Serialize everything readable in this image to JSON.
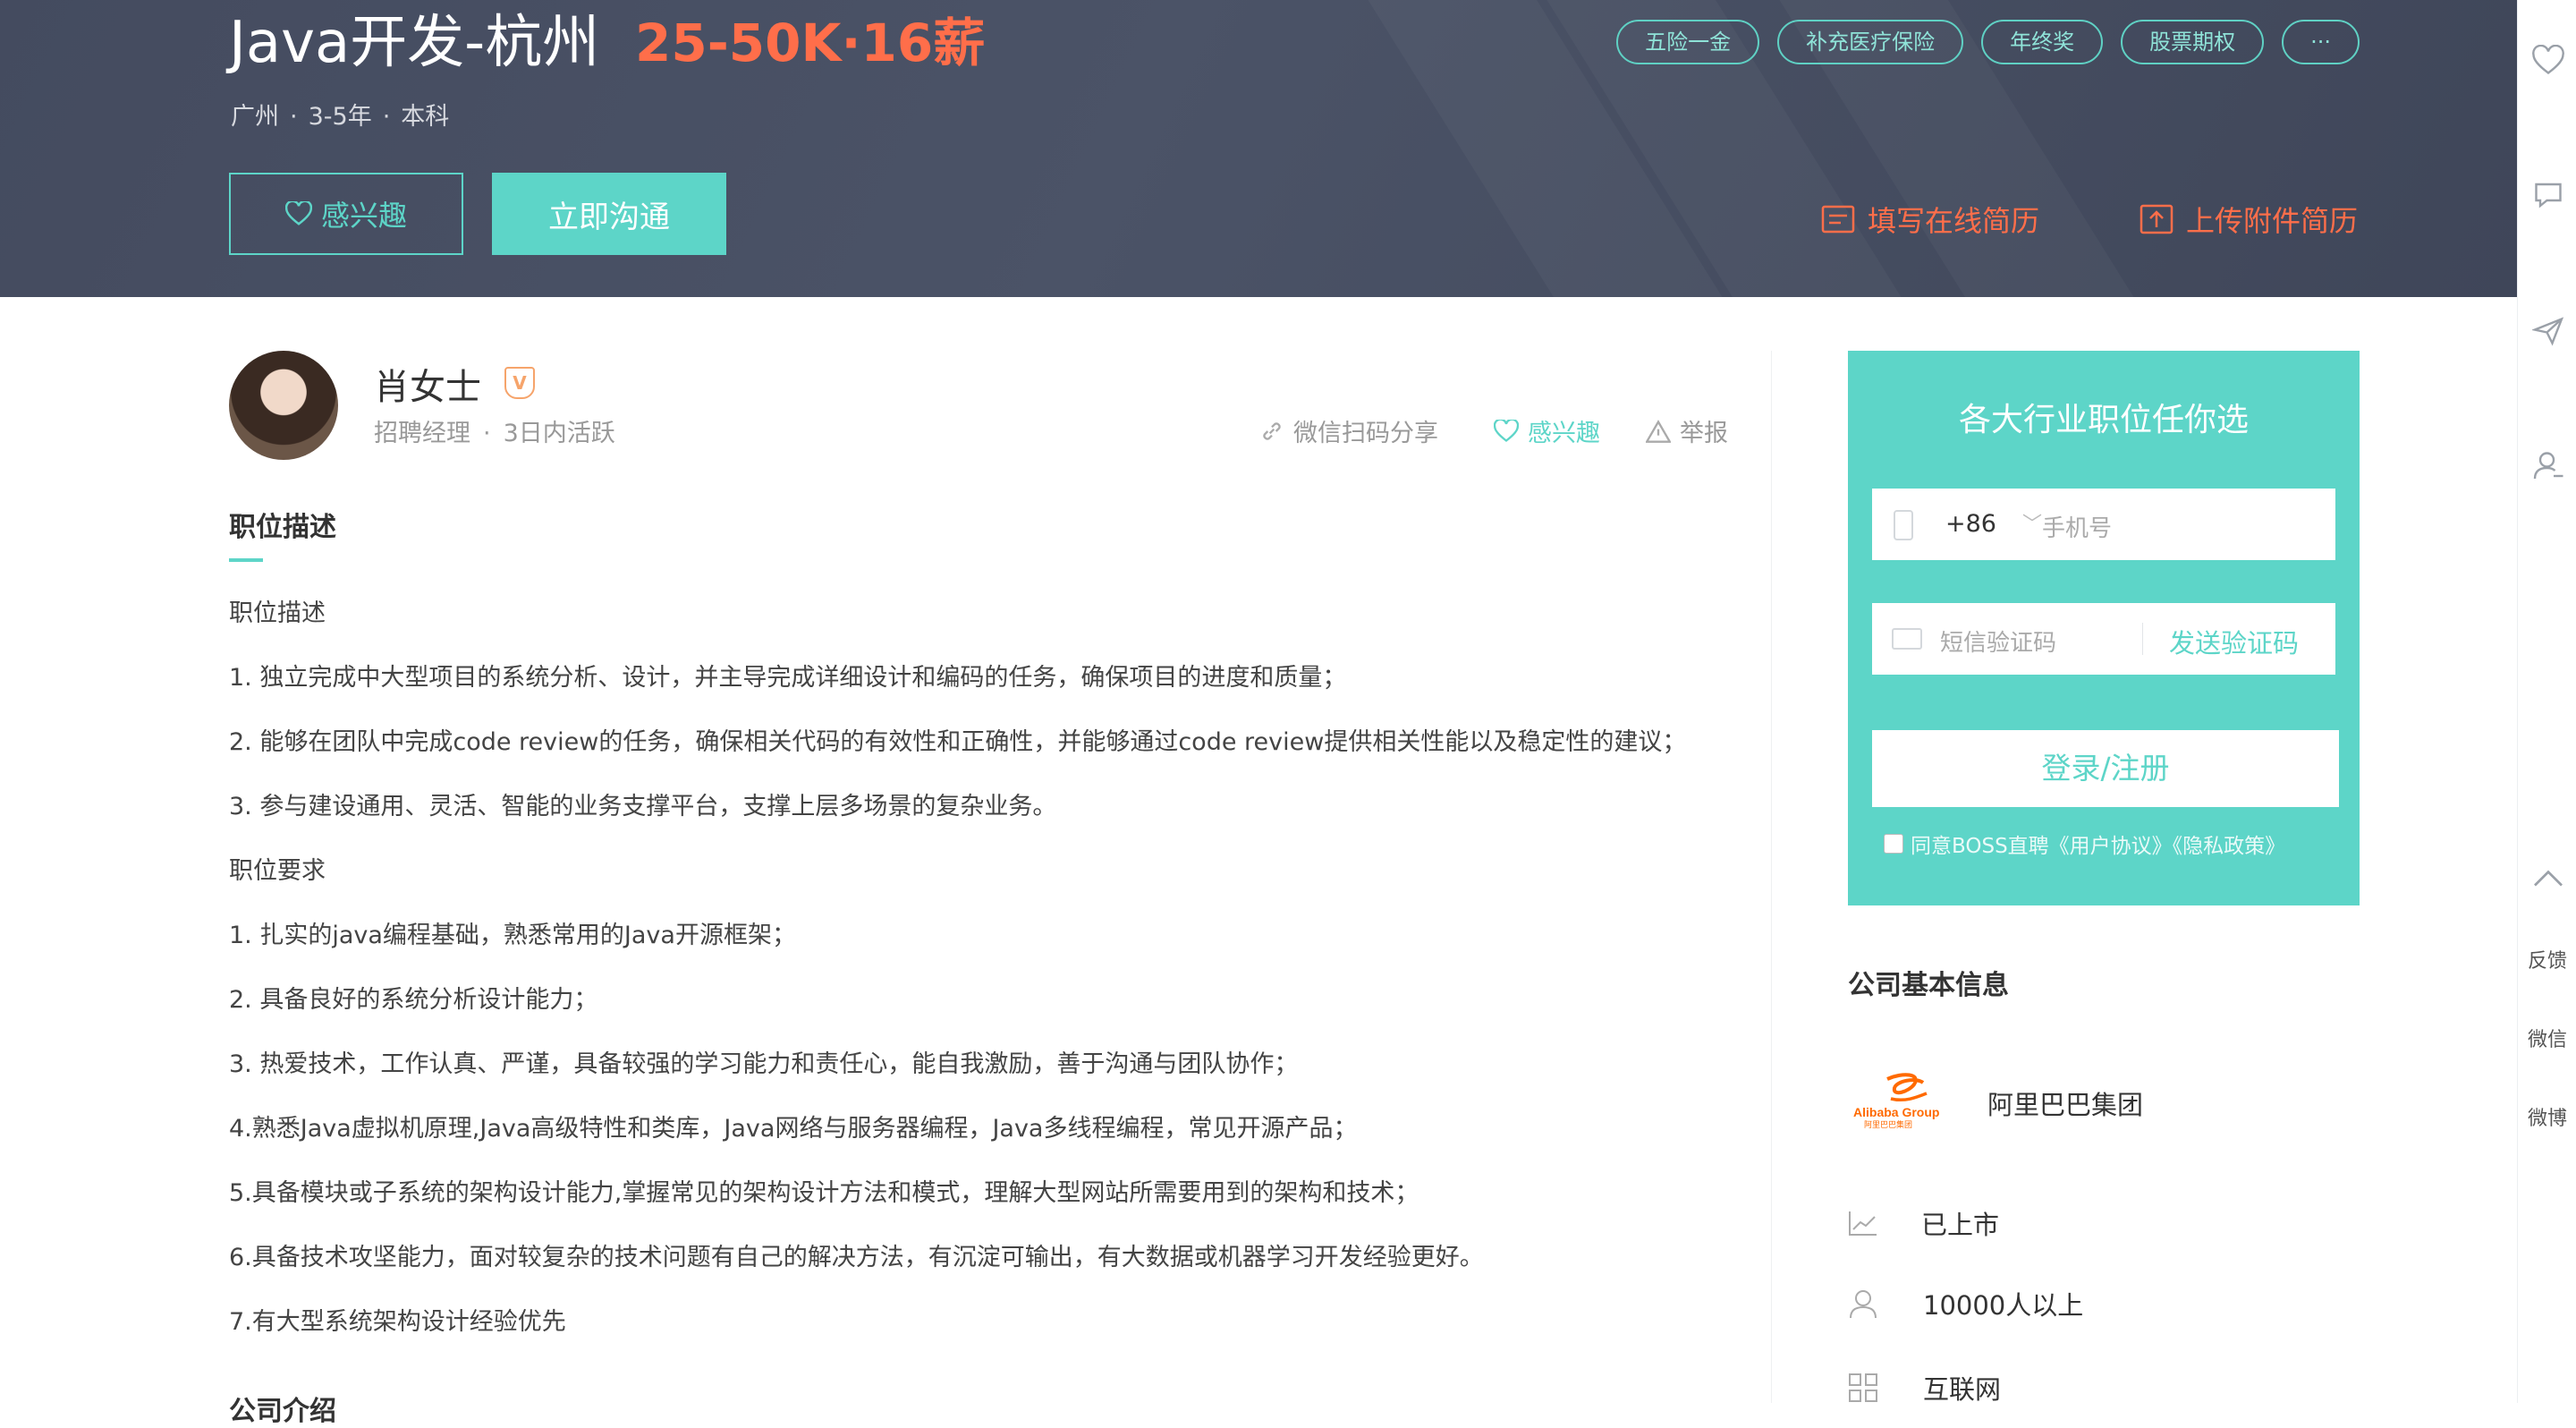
{
  "job": {
    "title": "Java开发-杭州",
    "salary": "25-50K·16薪",
    "city": "广州",
    "experience": "3-5年",
    "degree": "本科",
    "dot": "·",
    "tags": [
      "五险一金",
      "补充医疗保险",
      "年终奖",
      "股票期权",
      "···"
    ]
  },
  "actions": {
    "interest_label": "感兴趣",
    "chat_label": "立即沟通",
    "online_resume": "填写在线简历",
    "upload_resume": "上传附件简历"
  },
  "recruiter": {
    "name": "肖女士",
    "badge": "V",
    "role": "招聘经理",
    "dot": "·",
    "active": "3日内活跃",
    "share": "微信扫码分享",
    "interest": "感兴趣",
    "report": "举报"
  },
  "description": {
    "section_title": "职位描述",
    "lines": [
      "职位描述",
      "1. 独立完成中大型项目的系统分析、设计，并主导完成详细设计和编码的任务，确保项目的进度和质量；",
      "2. 能够在团队中完成code review的任务，确保相关代码的有效性和正确性，并能够通过code review提供相关性能以及稳定性的建议；",
      "3. 参与建设通用、灵活、智能的业务支撑平台，支撑上层多场景的复杂业务。",
      "职位要求",
      "1. 扎实的java编程基础，熟悉常用的Java开源框架；",
      "2. 具备良好的系统分析设计能力；",
      "3. 热爱技术，工作认真、严谨，具备较强的学习能力和责任心，能自我激励，善于沟通与团队协作；",
      "4.熟悉Java虚拟机原理,Java高级特性和类库，Java网络与服务器编程，Java多线程编程，常见开源产品；",
      "5.具备模块或子系统的架构设计能力,掌握常见的架构设计方法和模式，理解大型网站所需要用到的架构和技术；",
      "6.具备技术攻坚能力，面对较复杂的技术问题有自己的解决方法，有沉淀可输出，有大数据或机器学习开发经验更好。",
      "7.有大型系统架构设计经验优先"
    ],
    "company_intro_title": "公司介绍"
  },
  "login": {
    "title": "各大行业职位任你选",
    "prefix": "+86",
    "chevron": "﹀",
    "phone_placeholder": "手机号",
    "code_placeholder": "短信验证码",
    "send_code": "发送验证码",
    "login_button": "登录/注册",
    "agree_text": "同意BOSS直聘《用户协议》《隐私政策》"
  },
  "company": {
    "section_title": "公司基本信息",
    "name": "阿里巴巴集团",
    "logo_text": "Alibaba Group",
    "logo_cn": "阿里巴巴集团",
    "stage": "已上市",
    "size": "10000人以上",
    "industry": "互联网"
  },
  "sidebar": {
    "feedback": "反馈",
    "wechat": "微信",
    "weibo": "微博"
  },
  "colors": {
    "accent": "#5dd5c8",
    "salary": "#ff6e4a",
    "header_bg": "#474e62"
  }
}
